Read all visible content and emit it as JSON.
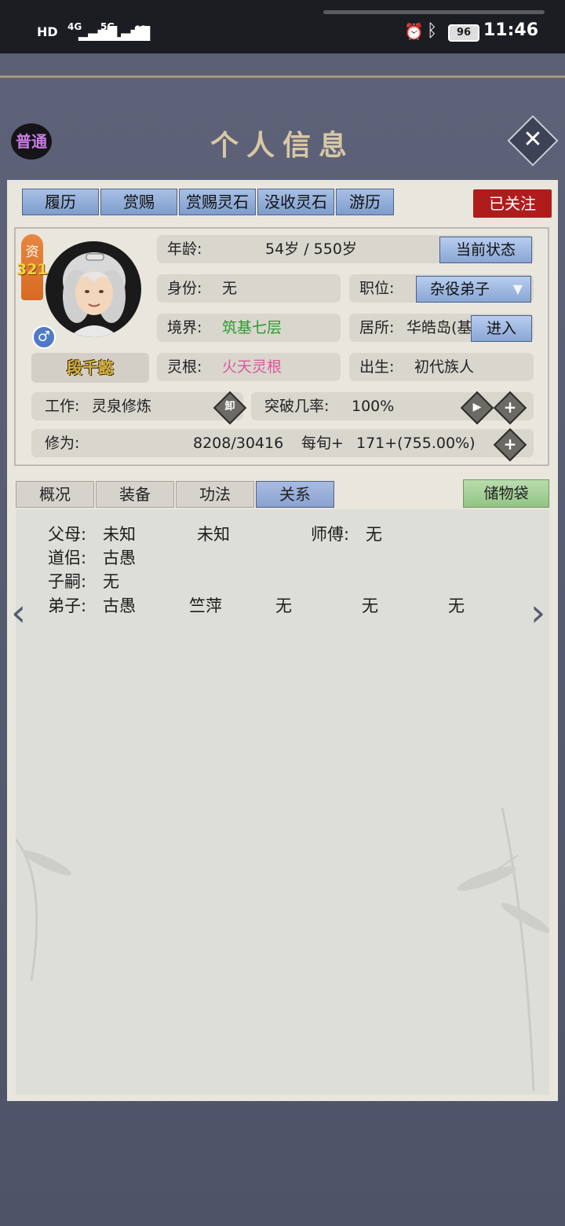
{
  "status_bar": {
    "left_icons": [
      "HD",
      "4G",
      "5G",
      "heart-icon"
    ],
    "battery": "96",
    "time": "11:46"
  },
  "header": {
    "badge": "普通",
    "title": "个人信息"
  },
  "top_tabs": [
    "履历",
    "赏赐",
    "赏赐灵石",
    "没收灵石",
    "游历"
  ],
  "follow_label": "已关注",
  "profile": {
    "zi_label": "资",
    "zi_value": "321",
    "name": "段千懿",
    "gender_symbol": "♂",
    "age_label": "年龄:",
    "age_value": "54岁 / 550岁",
    "current_state_btn": "当前状态",
    "identity_label": "身份:",
    "identity_value": "无",
    "position_label": "职位:",
    "position_value": "杂役弟子",
    "realm_label": "境界:",
    "realm_value": "筑基七层",
    "residence_label": "居所:",
    "residence_value": "华皓岛(基",
    "enter_btn": "进入",
    "root_label": "灵根:",
    "root_value": "火天灵根",
    "birth_label": "出生:",
    "birth_value": "初代族人",
    "work_label": "工作:",
    "work_value": "灵泉修炼",
    "unload_label": "卸",
    "breakthrough_label": "突破几率:",
    "breakthrough_value": "100%",
    "cultivation_label": "修为:",
    "cultivation_value": "8208/30416",
    "per_turn_label": "每旬+",
    "per_turn_value": "171+(755.00%)"
  },
  "bottom_tabs": [
    "概况",
    "装备",
    "功法",
    "关系"
  ],
  "storage_label": "储物袋",
  "relations": {
    "parents_label": "父母:",
    "parent1": "未知",
    "parent2": "未知",
    "master_label": "师傅:",
    "master": "无",
    "partner_label": "道侣:",
    "partner": "古愚",
    "children_label": "子嗣:",
    "children": "无",
    "disciples_label": "弟子:",
    "disciples": [
      "古愚",
      "竺萍",
      "无",
      "无",
      "无"
    ]
  },
  "colors": {
    "realm": "#2e9a2e",
    "root": "#d9599a",
    "follow_bg": "#b01c1c",
    "tab_blue": "#8aa6d4",
    "storage_green": "#a4cf95"
  }
}
